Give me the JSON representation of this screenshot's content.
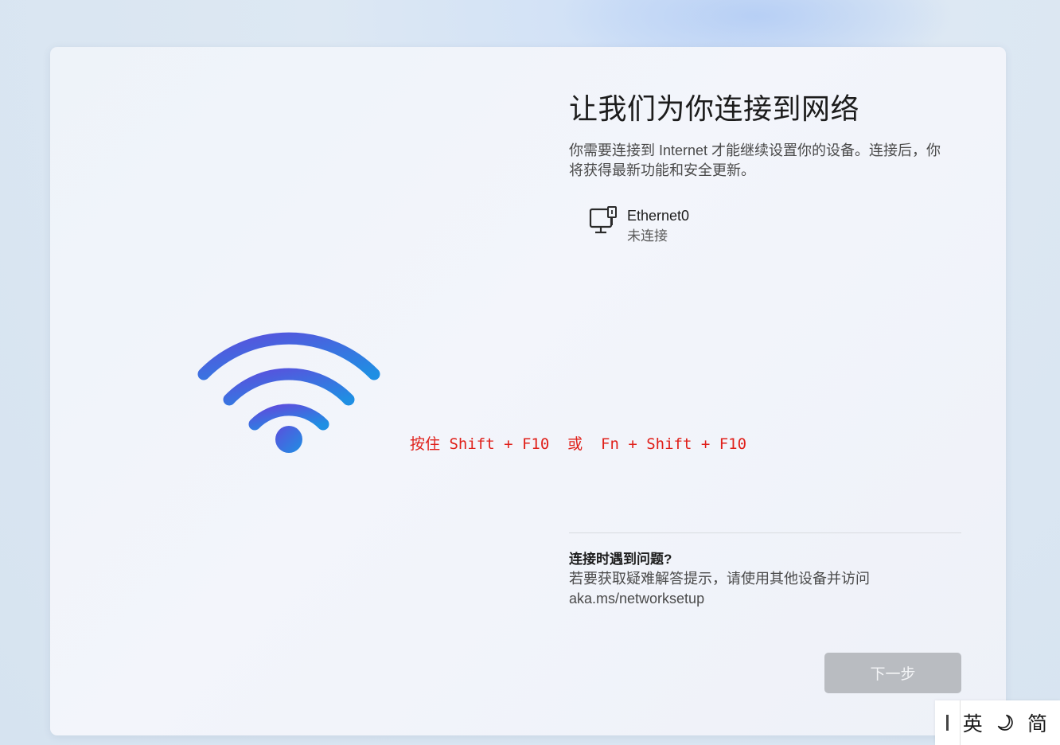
{
  "main": {
    "title": "让我们为你连接到网络",
    "description": "你需要连接到 Internet 才能继续设置你的设备。连接后，你将获得最新功能和安全更新。"
  },
  "network": {
    "name": "Ethernet0",
    "status": "未连接",
    "icon": "ethernet-icon"
  },
  "overlay": {
    "hint": "按住 Shift + F10  或  Fn + Shift + F10"
  },
  "help": {
    "title": "连接时遇到问题?",
    "text": "若要获取疑难解答提示，请使用其他设备并访问 aka.ms/networksetup"
  },
  "buttons": {
    "next": "下一步"
  },
  "ime": {
    "lang": "英",
    "mode_icon": "half-moon-icon",
    "script": "简"
  },
  "colors": {
    "hint_red": "#e0201a",
    "wifi_start": "#5a4fdc",
    "wifi_end": "#1f8ce0",
    "button_disabled": "#b9bcc1"
  }
}
